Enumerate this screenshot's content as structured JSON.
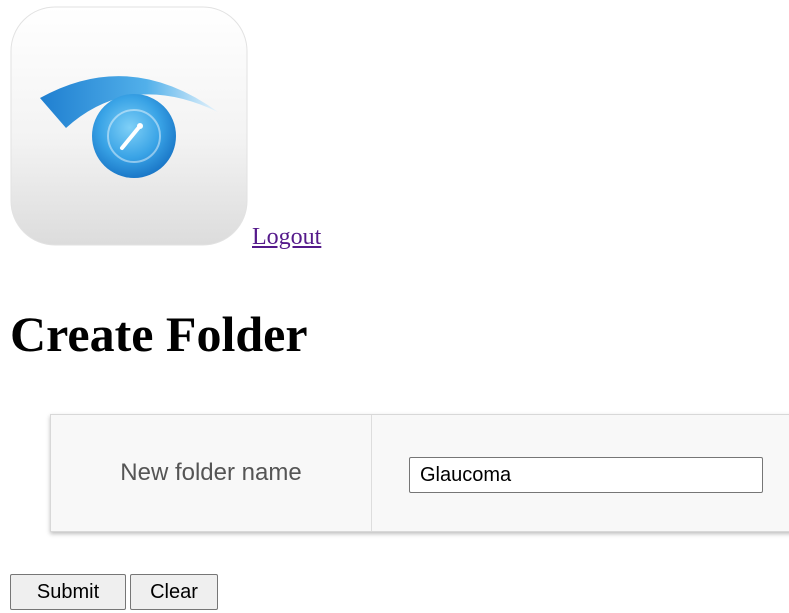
{
  "header": {
    "logo_icon": "eye-app-icon",
    "logout_label": "Logout"
  },
  "page": {
    "title": "Create Folder"
  },
  "form": {
    "folder_name_label": "New folder name",
    "folder_name_value": "Glaucoma"
  },
  "actions": {
    "submit_label": "Submit",
    "clear_label": "Clear"
  },
  "colors": {
    "link": "#551a8b",
    "icon_blue": "#2f8fd8"
  }
}
